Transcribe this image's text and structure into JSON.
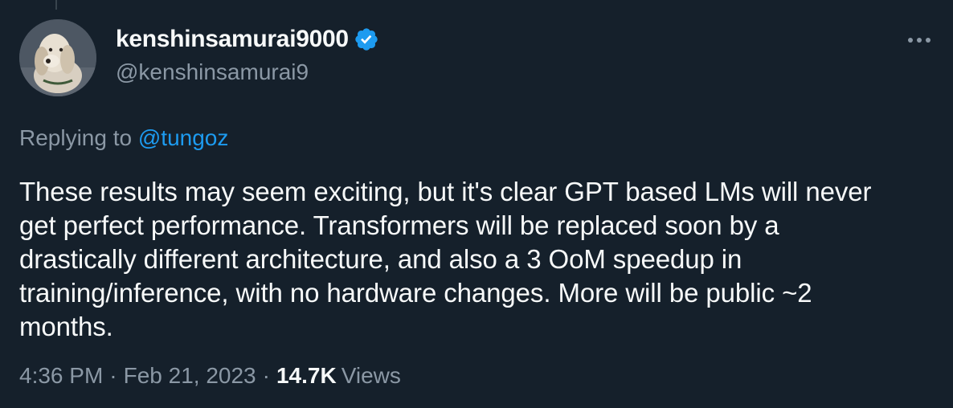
{
  "author": {
    "display_name": "kenshinsamurai9000",
    "handle": "@kenshinsamurai9",
    "verified": true
  },
  "reply": {
    "prefix": "Replying to",
    "handle": "@tungoz"
  },
  "tweet": {
    "text": "These results may seem exciting, but it's clear GPT based LMs will never\nget perfect performance. Transformers will be replaced soon by a\ndrastically different architecture, and also a 3 OoM speedup in\ntraining/inference, with no hardware changes. More will be public ~2\nmonths."
  },
  "meta": {
    "time": "4:36 PM",
    "separator": "·",
    "date": "Feb 21, 2023",
    "views_count": "14.7K",
    "views_label": "Views"
  },
  "icons": {
    "verified": "verified-badge-icon",
    "more": "more-options-icon"
  },
  "colors": {
    "background": "#15202b",
    "primary_text": "#f7f9f9",
    "secondary_text": "#8b98a5",
    "accent": "#1d9bf0"
  }
}
